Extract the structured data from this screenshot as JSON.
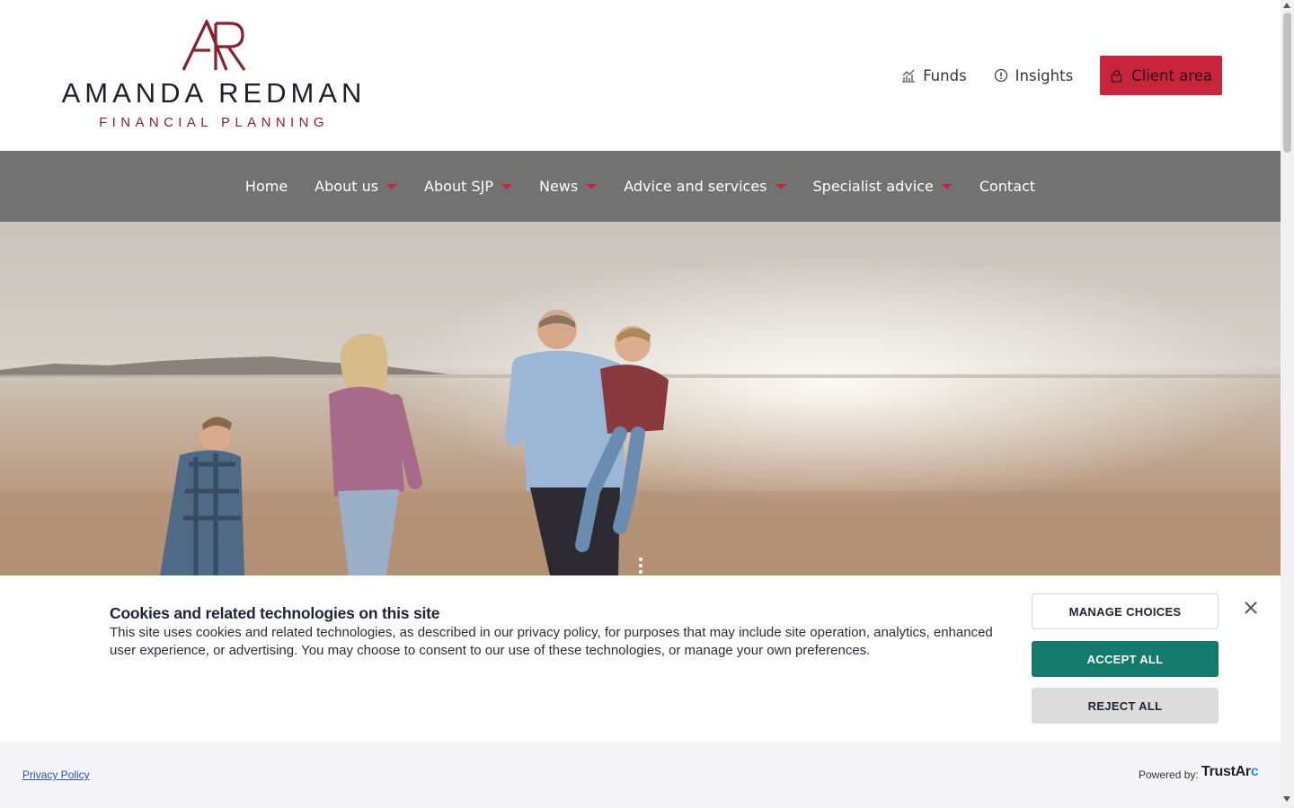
{
  "header": {
    "logo": {
      "monogram": "AR",
      "name": "AMANDA REDMAN",
      "tagline": "FINANCIAL PLANNING"
    },
    "links": [
      {
        "label": "Funds",
        "icon": "chart-icon"
      },
      {
        "label": "Insights",
        "icon": "alert-circle-icon"
      }
    ],
    "client_area": {
      "label": "Client area",
      "icon": "lock-icon"
    }
  },
  "nav": {
    "items": [
      {
        "label": "Home",
        "dropdown": false
      },
      {
        "label": "About us",
        "dropdown": true
      },
      {
        "label": "About SJP",
        "dropdown": true
      },
      {
        "label": "News",
        "dropdown": true
      },
      {
        "label": "Advice and services",
        "dropdown": true
      },
      {
        "label": "Specialist advice",
        "dropdown": true
      },
      {
        "label": "Contact",
        "dropdown": false
      }
    ]
  },
  "cookie_banner": {
    "title": "Cookies and related technologies on this site",
    "text": "This site uses cookies and related technologies, as described in our privacy policy, for purposes that may include site operation, analytics, enhanced user experience, or advertising. You may choose to consent to our use of these technologies, or manage your own preferences.",
    "manage_label": "MANAGE CHOICES",
    "accept_label": "ACCEPT ALL",
    "reject_label": "REJECT ALL",
    "privacy_link": "Privacy Policy",
    "powered_by": "Powered by:",
    "provider_main": "TrustAr",
    "provider_accent": "c"
  },
  "colors": {
    "brand_red": "#c8253c",
    "nav_bg": "#727272",
    "accept_green": "#137a6c"
  }
}
